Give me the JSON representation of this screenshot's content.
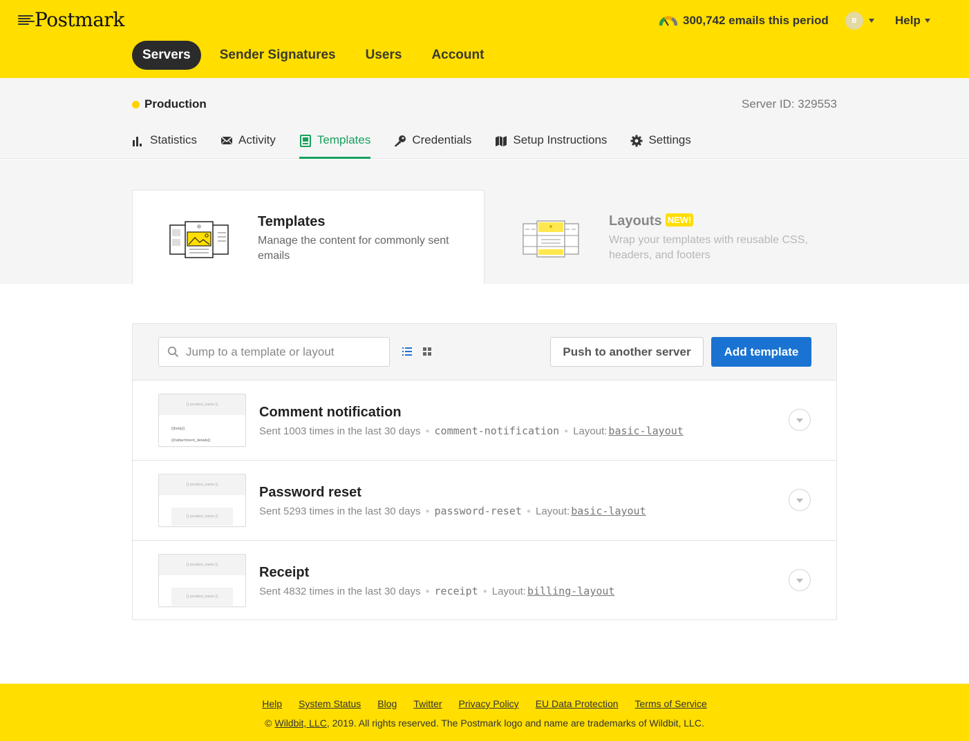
{
  "header": {
    "brand": "Postmark",
    "usage": "300,742 emails this period",
    "avatar_initial": "B",
    "help_label": "Help"
  },
  "main_nav": [
    {
      "label": "Servers",
      "active": true
    },
    {
      "label": "Sender Signatures",
      "active": false
    },
    {
      "label": "Users",
      "active": false
    },
    {
      "label": "Account",
      "active": false
    }
  ],
  "server": {
    "name": "Production",
    "id_text": "Server ID: 329553",
    "status_color": "#ffd200"
  },
  "sub_nav": [
    {
      "label": "Statistics",
      "icon": "bar-chart-icon",
      "active": false
    },
    {
      "label": "Activity",
      "icon": "envelope-icon",
      "active": false
    },
    {
      "label": "Templates",
      "icon": "template-icon",
      "active": true
    },
    {
      "label": "Credentials",
      "icon": "key-icon",
      "active": false
    },
    {
      "label": "Setup Instructions",
      "icon": "map-icon",
      "active": false
    },
    {
      "label": "Settings",
      "icon": "gear-icon",
      "active": false
    }
  ],
  "switcher": {
    "templates": {
      "title": "Templates",
      "description": "Manage the content for commonly sent emails"
    },
    "layouts": {
      "title": "Layouts",
      "badge": "NEW!",
      "description": "Wrap your templates with reusable CSS, headers, and footers"
    }
  },
  "toolbar": {
    "search_placeholder": "Jump to a template or layout",
    "push_label": "Push to another server",
    "add_label": "Add template"
  },
  "templates": [
    {
      "title": "Comment notification",
      "sent": "Sent 1003 times in the last 30 days",
      "alias": "comment-notification",
      "layout_label": "Layout:",
      "layout": "basic-layout",
      "thumb_header": "{{ product_name }}",
      "thumb_lines": [
        "{{body}}",
        "{{#attachment_details}}"
      ]
    },
    {
      "title": "Password reset",
      "sent": "Sent 5293 times in the last 30 days",
      "alias": "password-reset",
      "layout_label": "Layout:",
      "layout": "basic-layout",
      "thumb_header": "{{ product_name }}",
      "thumb_footer": "{{ product_name }}"
    },
    {
      "title": "Receipt",
      "sent": "Sent 4832 times in the last 30 days",
      "alias": "receipt",
      "layout_label": "Layout:",
      "layout": "billing-layout",
      "thumb_header": "{{ product_name }}",
      "thumb_footer": "{{ product_name }}"
    }
  ],
  "footer": {
    "links": [
      "Help",
      "System Status",
      "Blog",
      "Twitter",
      "Privacy Policy",
      "EU Data Protection",
      "Terms of Service"
    ],
    "copyright_prefix": "©",
    "copyright_link": "Wildbit, LLC",
    "copyright_suffix": ", 2019. All rights reserved. The Postmark logo and name are trademarks of Wildbit, LLC."
  },
  "colors": {
    "brand_yellow": "#ffde00",
    "active_tab_green": "#17a05d",
    "primary_blue": "#1a73d2",
    "dark_pill": "#2b2b2b"
  }
}
